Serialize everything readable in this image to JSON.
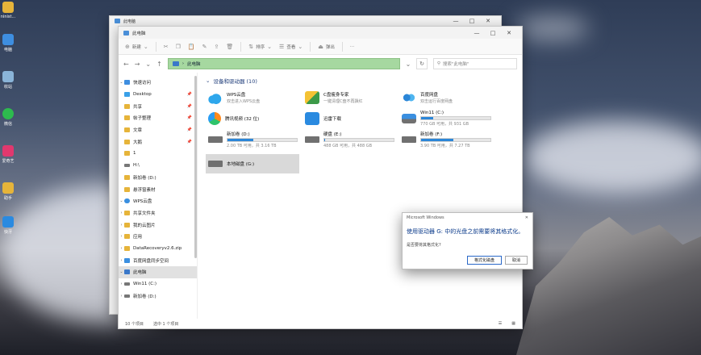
{
  "desktop": {
    "icons": [
      {
        "label": "ninist..."
      },
      {
        "label": "电脑"
      },
      {
        "label": "收站"
      },
      {
        "label": "微信"
      },
      {
        "label": "爱奇艺"
      },
      {
        "label": "助手"
      },
      {
        "label": "快牙"
      }
    ]
  },
  "back_window": {
    "title": "此电脑"
  },
  "window": {
    "title": "此电脑",
    "controls": {
      "minimize": "—",
      "maximize": "□",
      "close": "✕"
    },
    "toolbar": {
      "new_label": "新建",
      "sort_label": "排序",
      "view_label": "查看",
      "eject_label": "弹出",
      "more_label": "···"
    },
    "address": {
      "back": "←",
      "forward": "→",
      "down": "⌄",
      "up": "↑",
      "path": "此电脑",
      "refresh": "↻",
      "search_placeholder": "搜索\"此电脑\""
    },
    "sidebar": {
      "items": [
        {
          "label": "快速访问",
          "chev": "⌄",
          "pin": ""
        },
        {
          "label": "Desktop",
          "chev": "",
          "pin": "📌"
        },
        {
          "label": "共享",
          "chev": "",
          "pin": "📌"
        },
        {
          "label": "帖子整理",
          "chev": "",
          "pin": "📌"
        },
        {
          "label": "文章",
          "chev": "",
          "pin": "📌"
        },
        {
          "label": "大鹅",
          "chev": "",
          "pin": "📌"
        },
        {
          "label": "1",
          "chev": "",
          "pin": ""
        },
        {
          "label": "H:\\",
          "chev": "",
          "pin": ""
        },
        {
          "label": "新加卷 (D:)",
          "chev": "",
          "pin": ""
        },
        {
          "label": "悬浮窗素材",
          "chev": "",
          "pin": ""
        },
        {
          "label": "WPS云盘",
          "chev": "⌄",
          "pin": ""
        },
        {
          "label": "共享文件夹",
          "chev": "›",
          "pin": ""
        },
        {
          "label": "我的云图片",
          "chev": "›",
          "pin": ""
        },
        {
          "label": "应用",
          "chev": "›",
          "pin": ""
        },
        {
          "label": "DataRecoveryv2.6.zip",
          "chev": "›",
          "pin": ""
        },
        {
          "label": "百度网盘同步空间",
          "chev": "›",
          "pin": ""
        },
        {
          "label": "此电脑",
          "chev": "⌄",
          "pin": ""
        },
        {
          "label": "Win11 (C:)",
          "chev": "›",
          "pin": ""
        },
        {
          "label": "新加卷 (D:)",
          "chev": "›",
          "pin": ""
        }
      ]
    },
    "group": {
      "label": "设备和驱动器 (10)",
      "chev": "⌄"
    },
    "devices": [
      {
        "name": "WPS云盘",
        "sub": "双击进入WPS云盘",
        "fill": 0
      },
      {
        "name": "C盘瘦身专家",
        "sub": "一键清理C盘不再飘红",
        "fill": 0
      },
      {
        "name": "百度网盘",
        "sub": "双击运行百度网盘",
        "fill": 0
      },
      {
        "name": "腾讯视频 (32 位)",
        "sub": "",
        "fill": 0
      },
      {
        "name": "迅雷下载",
        "sub": "",
        "fill": 0
      },
      {
        "name": "Win11 (C:)",
        "sub": "770 GB 可用，共 931 GB",
        "fill": 0.17
      },
      {
        "name": "新加卷 (D:)",
        "sub": "2.00 TB 可用，共 3.16 TB",
        "fill": 0.37
      },
      {
        "name": "硬盘 (E:)",
        "sub": "488 GB 可用，共 488 GB",
        "fill": 0.01
      },
      {
        "name": "新加卷 (F:)",
        "sub": "3.90 TB 可用，共 7.27 TB",
        "fill": 0.46
      },
      {
        "name": "本地磁盘 (G:)",
        "sub": "",
        "fill": 0
      }
    ],
    "status": {
      "count": "10 个项目",
      "selected": "选中 1 个项目"
    }
  },
  "dialog": {
    "title": "Microsoft Windows",
    "close": "✕",
    "message": "使用驱动器 G: 中的光盘之前需要将其格式化。",
    "question": "是否要将其格式化?",
    "format_label": "格式化磁盘",
    "cancel_label": "取消"
  },
  "colors": {
    "address_bg": "#a6d8a0",
    "accent": "#2b86d8",
    "selected_tile": "#d9d9d9"
  }
}
